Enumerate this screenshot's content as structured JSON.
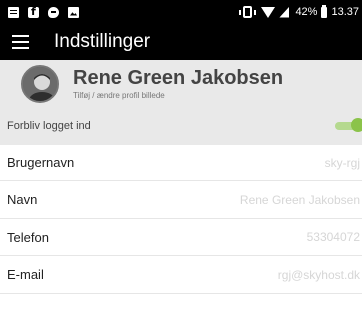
{
  "status_bar": {
    "icons": [
      "notes-icon",
      "facebook-icon",
      "messenger-icon",
      "gallery-icon"
    ],
    "right_icons": [
      "vibrate-icon",
      "wifi-icon",
      "signal-icon",
      "battery-icon"
    ],
    "battery": "42%",
    "time": "13.37"
  },
  "toolbar": {
    "menu_icon": "hamburger-menu-icon",
    "title": "Indstillinger"
  },
  "profile": {
    "name": "Rene Green Jakobsen",
    "subtitle": "Tilføj / ændre profil billede"
  },
  "settings": {
    "stay_logged_in": {
      "label": "Forbliv logget ind",
      "enabled": true,
      "color": "#8bc34a"
    },
    "username": {
      "label": "Brugernavn",
      "value": "sky-rgj"
    },
    "name": {
      "label": "Navn",
      "value": "Rene Green Jakobsen"
    },
    "phone": {
      "label": "Telefon",
      "value": "53304072"
    },
    "email": {
      "label": "E-mail",
      "value": "rgj@skyhost.dk"
    }
  },
  "colors": {
    "toolbar_bg": "#000000",
    "profile_bg": "#e9e9e9",
    "accent": "#8bc34a",
    "value_text": "#d6d6d6"
  }
}
